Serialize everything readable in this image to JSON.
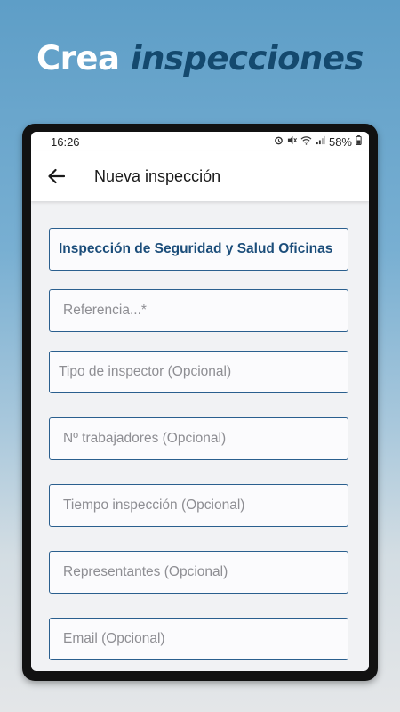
{
  "promo": {
    "headline_word1": "Crea",
    "headline_word2": "inspecciones"
  },
  "statusbar": {
    "time": "16:26",
    "battery": "58%",
    "icons": [
      "alarm-icon",
      "mute-icon",
      "wifi-icon",
      "signal-icon",
      "battery-icon"
    ]
  },
  "appbar": {
    "back_icon": "arrow-back-icon",
    "title": "Nueva inspección"
  },
  "form": {
    "selected_type": "Inspección de Seguridad y Salud Oficinas",
    "reference_placeholder": "Referencia...*",
    "inspector_type_placeholder": "Tipo de inspector (Opcional)",
    "workers_placeholder": "Nº trabajadores (Opcional)",
    "time_placeholder": "Tiempo inspección (Opcional)",
    "representatives_placeholder": "Representantes (Opcional)",
    "email_placeholder": "Email (Opcional)"
  },
  "colors": {
    "accent": "#1b4d7a",
    "field_border": "#2a5f8e",
    "headline_highlight": "#14496e"
  }
}
